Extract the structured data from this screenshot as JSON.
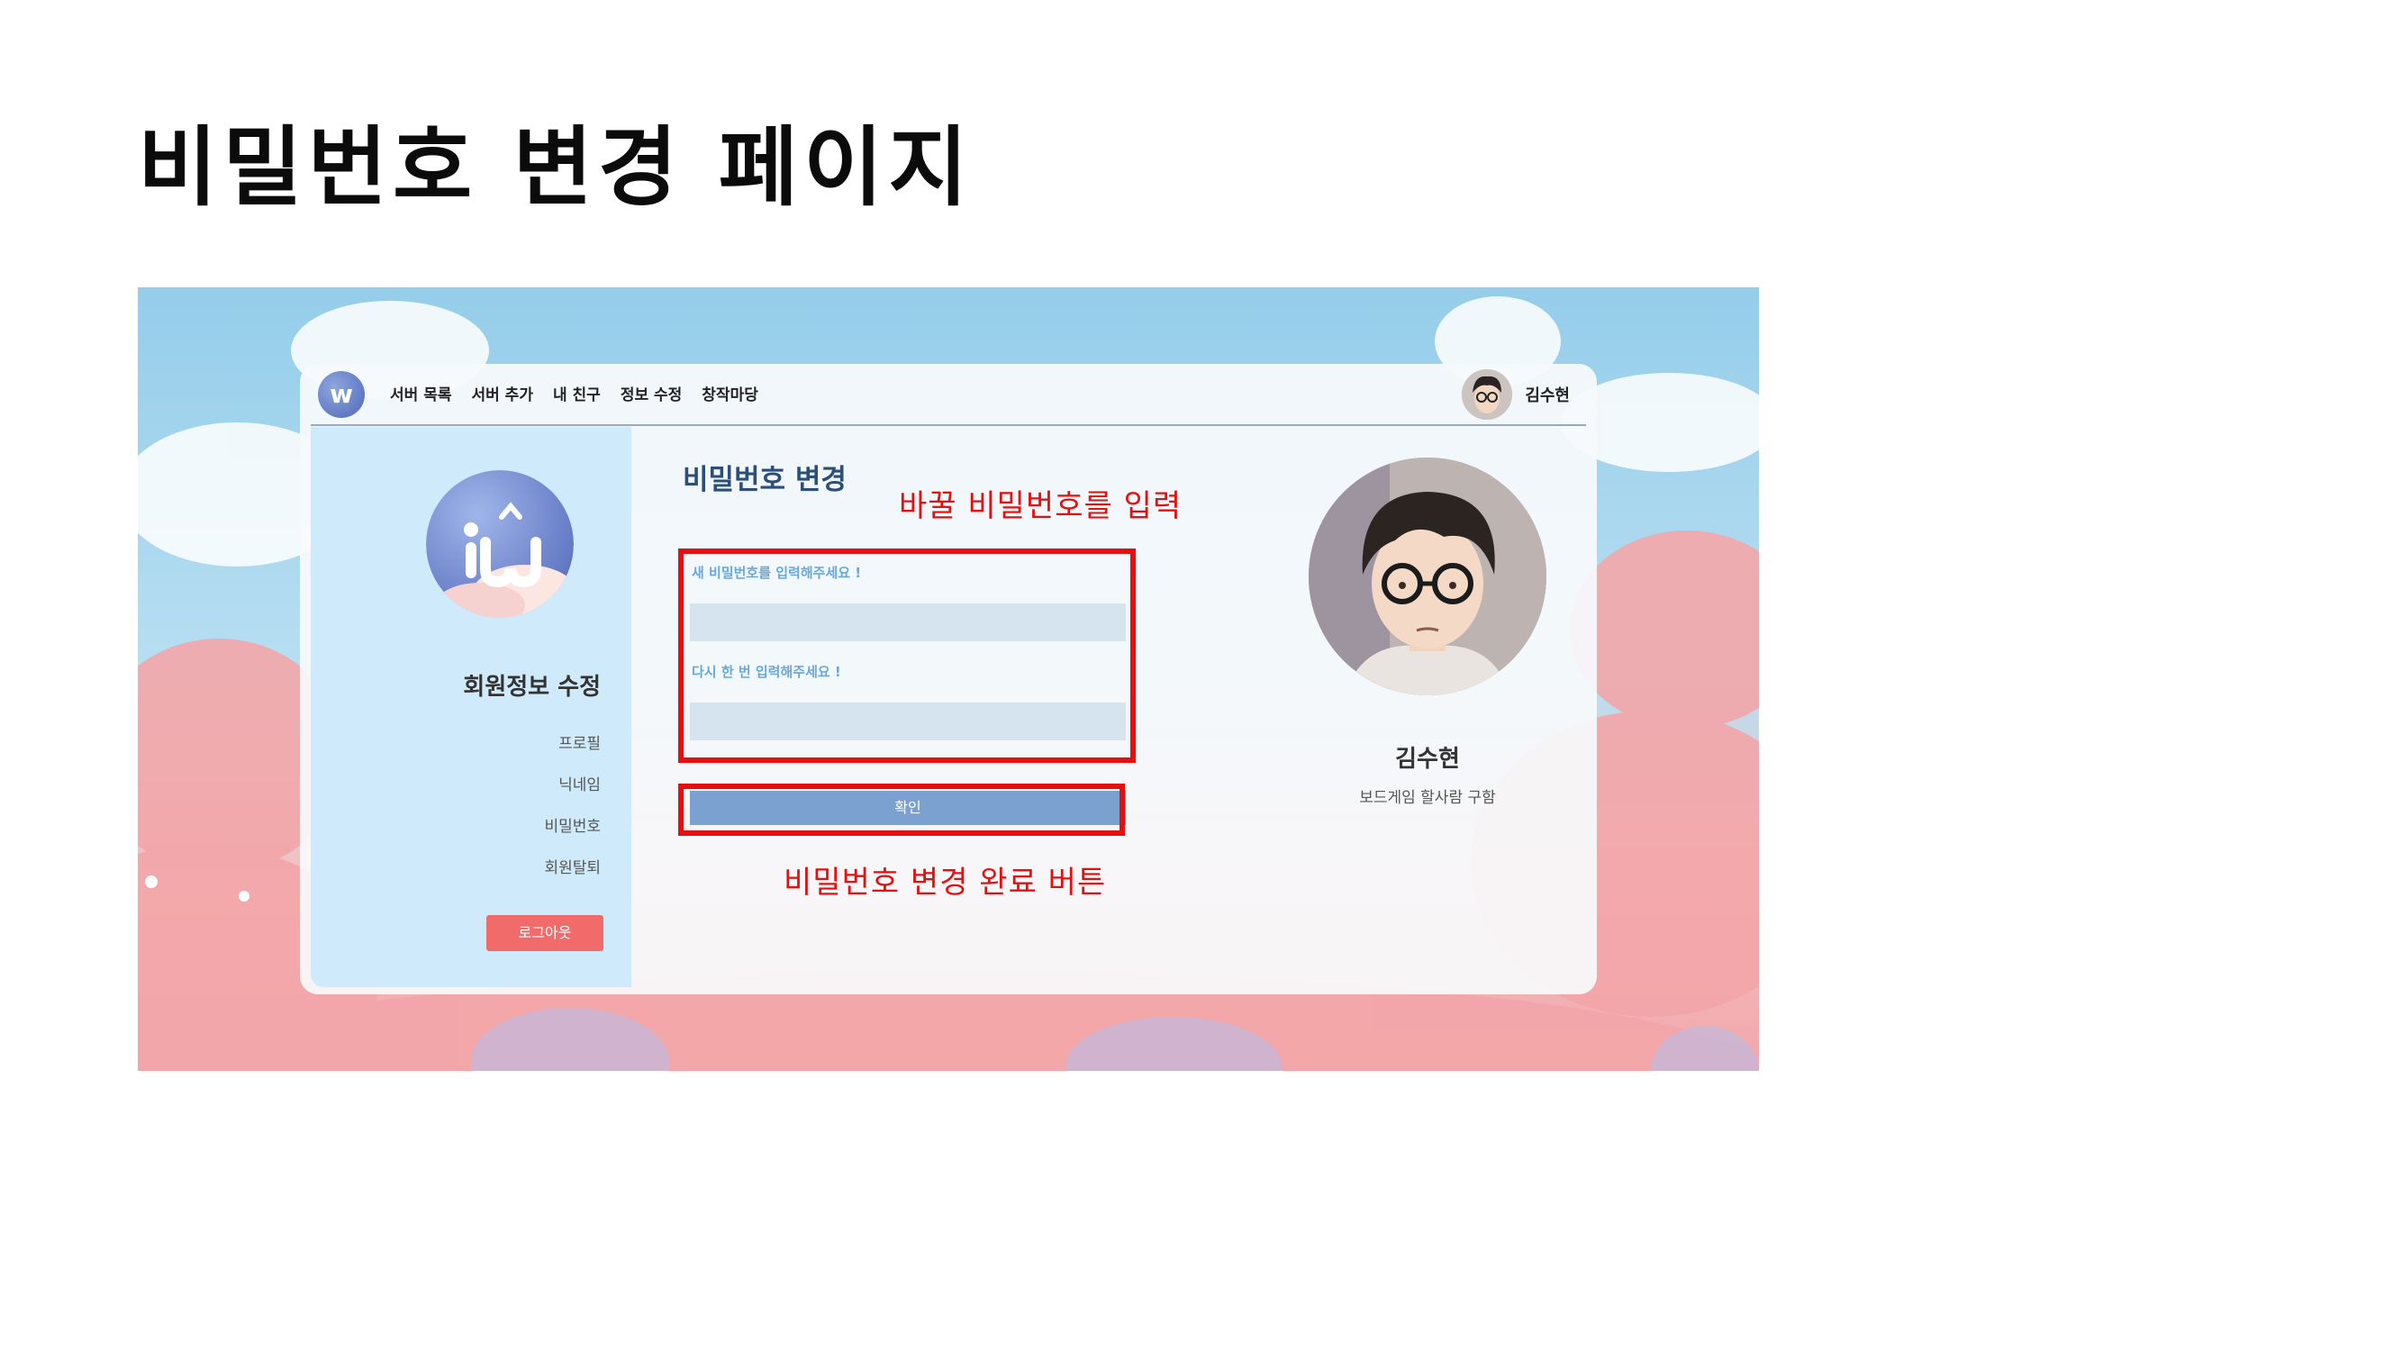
{
  "slide": {
    "title": "비밀번호 변경 페이지"
  },
  "app": {
    "nav": {
      "logo": "w",
      "menu": [
        "서버 목록",
        "서버 추가",
        "내 친구",
        "정보 수정",
        "창작마당"
      ],
      "user_name": "김수현"
    },
    "sidebar": {
      "title": "회원정보 수정",
      "items": [
        "프로필",
        "닉네임",
        "비밀번호",
        "회원탈퇴"
      ],
      "logout_label": "로그아웃"
    },
    "form": {
      "title": "비밀번호 변경",
      "new_password_label": "새 비밀번호를 입력해주세요 !",
      "new_password_value": "",
      "confirm_password_label": "다시 한 번 입력해주세요 !",
      "confirm_password_value": "",
      "submit_label": "확인"
    },
    "profile": {
      "name": "김수현",
      "status": "보드게임 할사람 구함"
    }
  },
  "annotations": {
    "input_note": "바꿀 비밀번호를 입력",
    "button_note": "비밀번호 변경 완료 버튼",
    "highlight_color": "#e60f0f"
  },
  "colors": {
    "sidebar": "#cfeafb",
    "logout": "#f26b6b",
    "confirm": "#7aa1cf",
    "form_title": "#2b4f7a",
    "label": "#6aa8d8"
  }
}
